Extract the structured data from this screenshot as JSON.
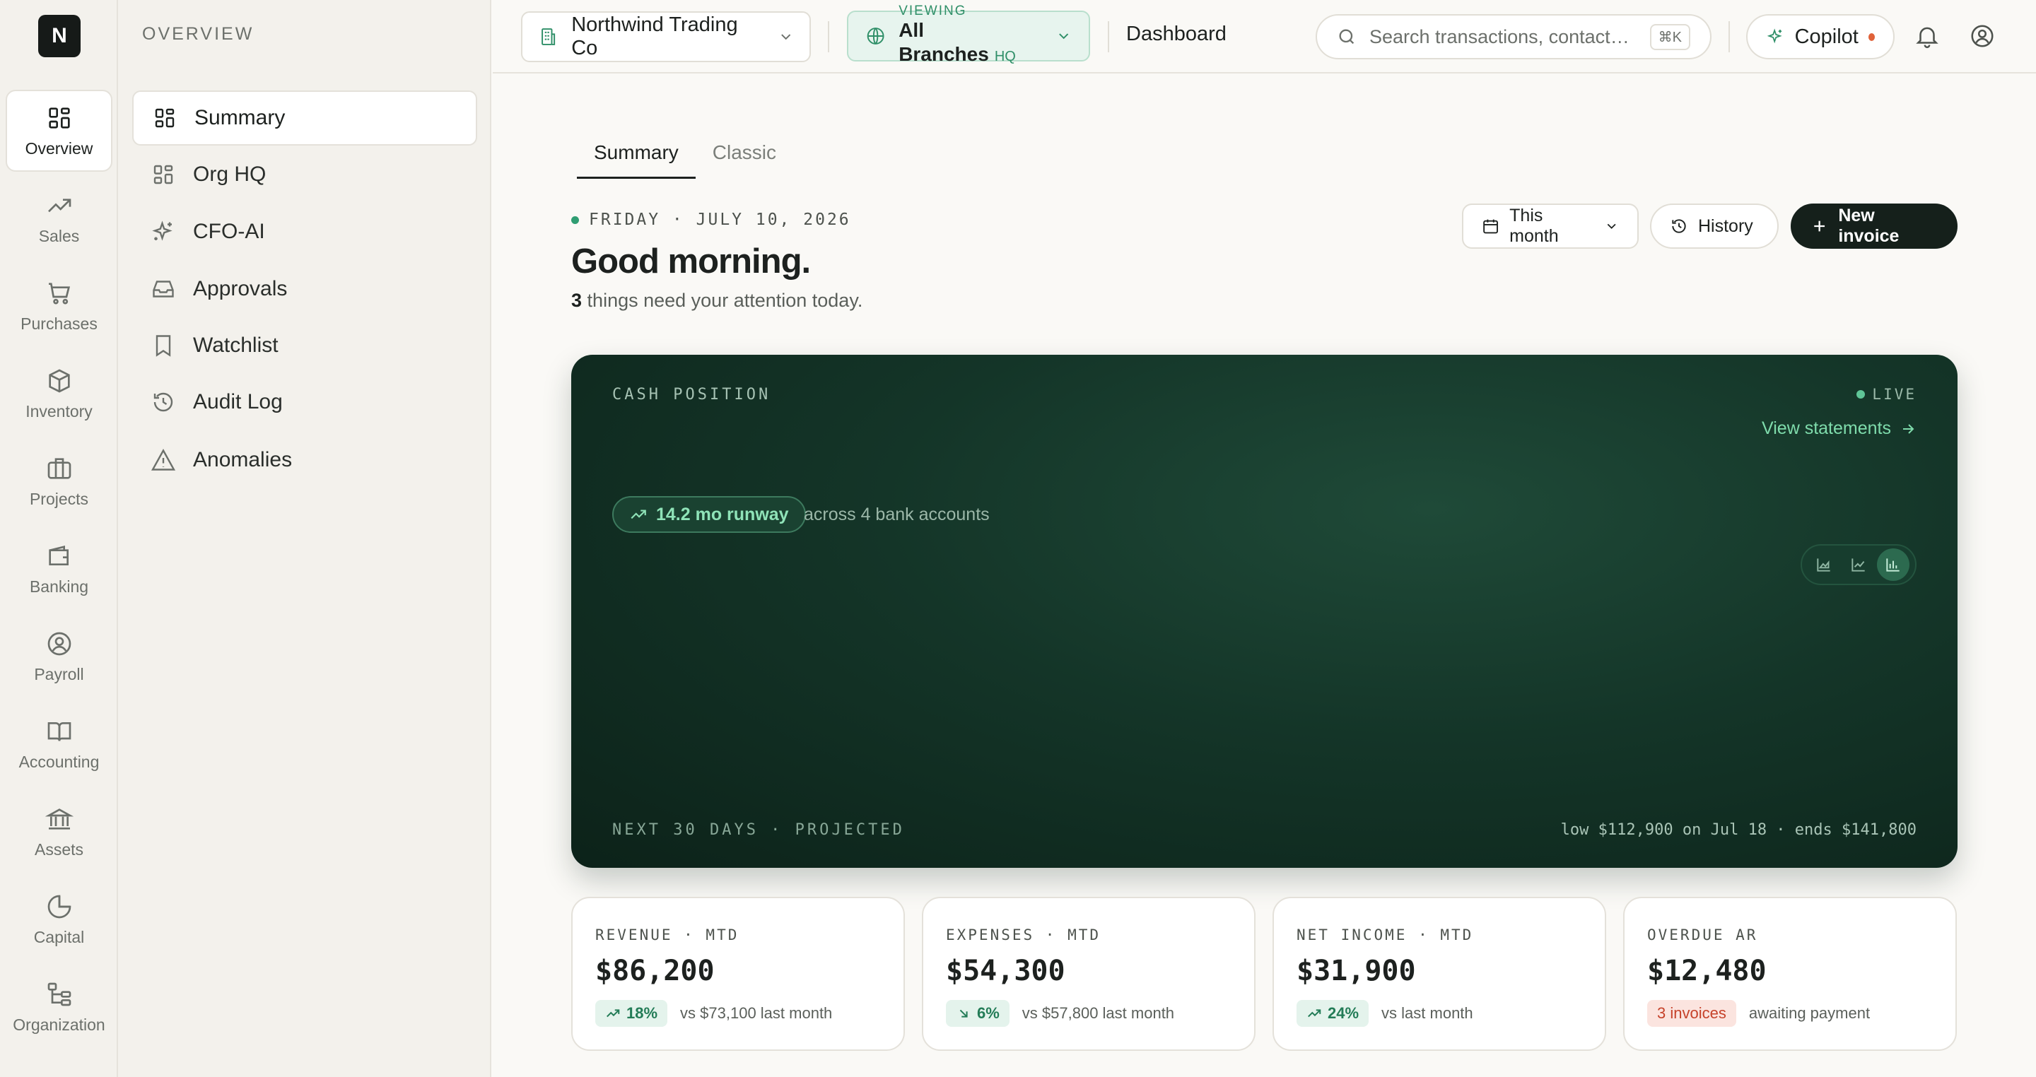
{
  "app": {
    "logo_letter": "N"
  },
  "rail": [
    {
      "label": "Overview",
      "icon": "grid-icon",
      "active": true
    },
    {
      "label": "Sales",
      "icon": "trending-up-icon"
    },
    {
      "label": "Purchases",
      "icon": "cart-icon"
    },
    {
      "label": "Inventory",
      "icon": "box-icon"
    },
    {
      "label": "Projects",
      "icon": "briefcase-icon"
    },
    {
      "label": "Banking",
      "icon": "wallet-icon"
    },
    {
      "label": "Payroll",
      "icon": "user-circle-icon"
    },
    {
      "label": "Accounting",
      "icon": "book-icon"
    },
    {
      "label": "Assets",
      "icon": "bank-icon"
    },
    {
      "label": "Capital",
      "icon": "pie-icon"
    },
    {
      "label": "Organization",
      "icon": "org-tree-icon"
    }
  ],
  "subnav": {
    "heading": "OVERVIEW",
    "items": [
      {
        "label": "Summary",
        "icon": "grid-icon",
        "active": true
      },
      {
        "label": "Org HQ",
        "icon": "grid-icon"
      },
      {
        "label": "CFO-AI",
        "icon": "sparkle-icon"
      },
      {
        "label": "Approvals",
        "icon": "inbox-icon"
      },
      {
        "label": "Watchlist",
        "icon": "bookmark-icon"
      },
      {
        "label": "Audit Log",
        "icon": "history-icon"
      },
      {
        "label": "Anomalies",
        "icon": "warning-icon"
      }
    ]
  },
  "topbar": {
    "company": "Northwind Trading Co",
    "viewing_label": "VIEWING",
    "viewing_value": "All Branches",
    "viewing_badge": "HQ",
    "breadcrumb": "Dashboard",
    "search_placeholder": "Search transactions, contacts,...",
    "search_shortcut": "⌘K",
    "copilot_label": "Copilot"
  },
  "main": {
    "tabs": [
      "Summary",
      "Classic"
    ],
    "date": "FRIDAY · JULY 10, 2026",
    "greeting": "Good morning.",
    "attention_count": "3",
    "attention_text": "things need your attention today.",
    "period_label": "This month",
    "history_label": "History",
    "new_invoice_label": "New invoice"
  },
  "cash": {
    "label": "CASH POSITION",
    "live": "LIVE",
    "view_statements": "View statements",
    "runway": "14.2 mo runway",
    "accounts_text": "across 4 bank accounts",
    "projection_label": "NEXT 30 DAYS · PROJECTED",
    "projection_summary": "low $112,900 on Jul 18 · ends $141,800",
    "chart_types": [
      "area-chart-icon",
      "line-chart-icon",
      "bar-chart-icon"
    ],
    "selected_chart_type": "bar-chart-icon"
  },
  "kpis": [
    {
      "label": "REVENUE · MTD",
      "value": "$86,200",
      "chip": "18%",
      "chip_icon": "arrow-up-right-icon",
      "note": "vs $73,100 last month"
    },
    {
      "label": "EXPENSES · MTD",
      "value": "$54,300",
      "chip": "6%",
      "chip_icon": "arrow-down-right-icon",
      "note": "vs $57,800 last month"
    },
    {
      "label": "NET INCOME · MTD",
      "value": "$31,900",
      "chip": "24%",
      "chip_icon": "arrow-up-right-icon",
      "note": "vs last month"
    },
    {
      "label": "OVERDUE AR",
      "value": "$12,480",
      "chip": "3 invoices",
      "chip_style": "red",
      "note": "awaiting payment"
    }
  ],
  "colors": {
    "accent": "#2f8f68",
    "dark": "#15201b",
    "card_bg": "#143528",
    "alert": "#c6422a"
  }
}
